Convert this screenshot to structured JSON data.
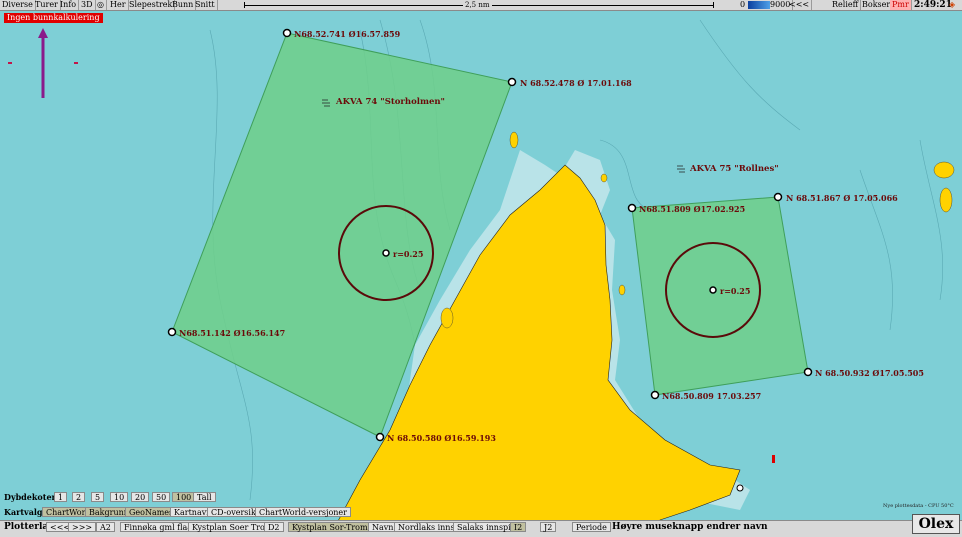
{
  "topbar": {
    "menus": [
      "Diverse",
      "Turer",
      "Info",
      "3D",
      "Her",
      "Slepestrek",
      "Bunn",
      "Snitt"
    ],
    "scale_label": "2,5 nm",
    "depth_min": "0",
    "depth_max": "9000",
    "nav_back": "<<<",
    "relieff": "Relieff",
    "bokser": "Bokser",
    "pmr": "Pmr",
    "clock": "2:49:21"
  },
  "warning": "Ingen bunnkalkulering",
  "map": {
    "colors": {
      "sea": "#7ecfd6",
      "land": "#ffd200",
      "shallow": "#b9e3e8",
      "zone": "#6fcf8a",
      "circle": "#5a0a0a",
      "label": "#6b0a0a"
    },
    "zone1": {
      "name": "AKVA 74 \"Storholmen\"",
      "corners": [
        "N68.52.741 Ø16.57.859",
        "N 68.52.478 Ø 17.01.168",
        "N 68.50.580 Ø16.59.193",
        "N68.51.142 Ø16.56.147"
      ],
      "radius": "r=0.25"
    },
    "zone2": {
      "name": "AKVA 75 \"Rollnes\"",
      "corners": [
        "N68.51.809 Ø17.02.925",
        "N 68.51.867 Ø 17.05.066",
        "N 68.50.932 Ø17.05.505",
        "N68.50.809 17.03.257"
      ],
      "radius": "r=0.25"
    }
  },
  "bottom": {
    "dybdekoter_label": "Dybdekoter",
    "dybdekoter": [
      "1",
      "2",
      "5",
      "10",
      "20",
      "50",
      "100",
      "Tall"
    ],
    "kartvalg_label": "Kartvalg",
    "kartvalg": [
      "ChartWorld",
      "Bakgrunn",
      "GeoNames",
      "Kartnavn",
      "CD-oversikt",
      "ChartWorld-versjoner"
    ],
    "plotterlag_label": "Plotterlag",
    "plotterlag": [
      "<<<",
      ">>>",
      "A2",
      "Finnøka gml flaate",
      "Kystplan Soer Troms",
      "D2",
      "Kystplan Sor-Troms-A",
      "Navn",
      "Nordlaks innspill",
      "Salaks innspill",
      "I2",
      "J2",
      "Periode"
    ],
    "hint": "Høyre museknapp endrer navn",
    "footnote": "Nye plottesdata - CPU 50°C",
    "logo": "Olex"
  }
}
